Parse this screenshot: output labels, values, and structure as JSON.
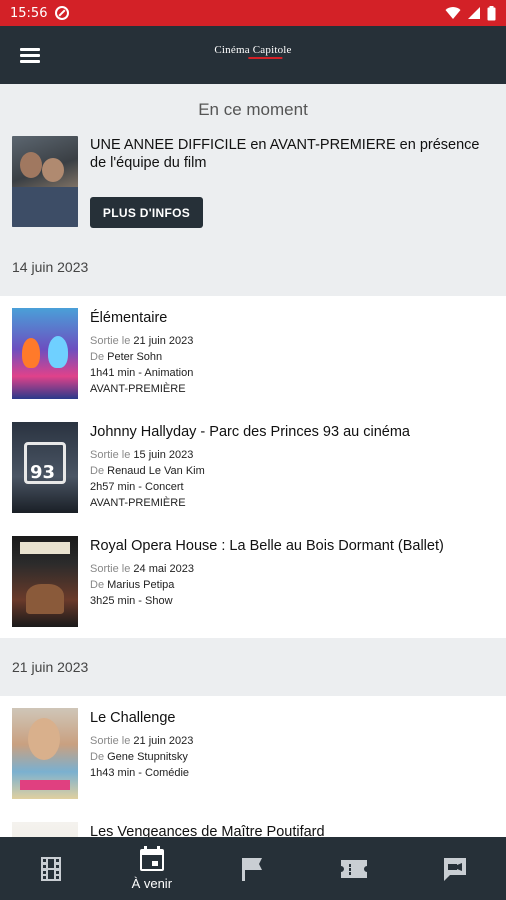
{
  "status_bar": {
    "time": "15:56"
  },
  "app_bar": {
    "logo_text": "Cinéma Capitole"
  },
  "featured": {
    "section_title": "En ce moment",
    "text": "UNE ANNEE DIFFICILE en AVANT-PREMIERE en présence de l'équipe du film",
    "button_label": "PLUS D'INFOS"
  },
  "groups": [
    {
      "date": "14 juin 2023",
      "movies": [
        {
          "title": "Élémentaire",
          "release_label": "Sortie le",
          "release_date": "21 juin 2023",
          "by_label": "De",
          "director": "Peter Sohn",
          "details": "1h41 min - Animation",
          "tag": "AVANT-PREMIÈRE"
        },
        {
          "title": "Johnny Hallyday - Parc des Princes 93 au cinéma",
          "release_label": "Sortie le",
          "release_date": "15 juin 2023",
          "by_label": "De",
          "director": "Renaud Le Van Kim",
          "details": "2h57 min - Concert",
          "tag": "AVANT-PREMIÈRE"
        },
        {
          "title": "Royal Opera House : La Belle au Bois Dormant (Ballet)",
          "release_label": "Sortie le",
          "release_date": "24 mai 2023",
          "by_label": "De",
          "director": "Marius Petipa",
          "details": "3h25 min - Show",
          "tag": ""
        }
      ]
    },
    {
      "date": "21 juin 2023",
      "movies": [
        {
          "title": "Le Challenge",
          "release_label": "Sortie le",
          "release_date": "21 juin 2023",
          "by_label": "De",
          "director": "Gene Stupnitsky",
          "details": "1h43 min - Comédie",
          "tag": ""
        },
        {
          "title": "Les Vengeances de Maître Poutifard"
        }
      ]
    }
  ],
  "tabs": [
    {
      "icon": "film-icon",
      "label": ""
    },
    {
      "icon": "calendar-icon",
      "label": "À venir",
      "active": true
    },
    {
      "icon": "flag-icon",
      "label": ""
    },
    {
      "icon": "ticket-icon",
      "label": ""
    },
    {
      "icon": "message-icon",
      "label": ""
    }
  ],
  "colors": {
    "status_bar": "#d32127",
    "app_bar": "#263038",
    "section_bg": "#eceef0"
  }
}
